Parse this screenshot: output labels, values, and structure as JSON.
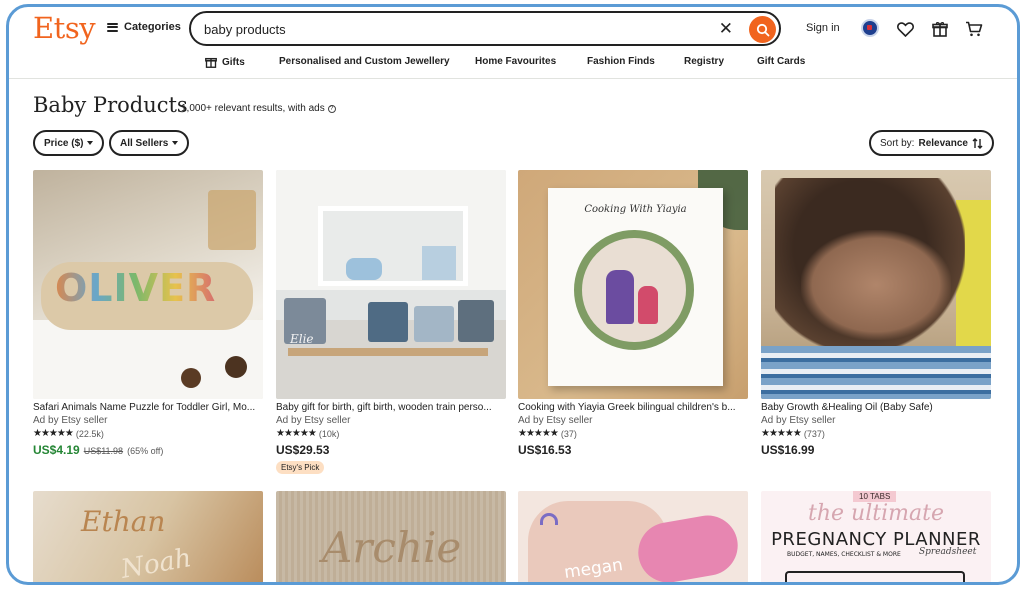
{
  "header": {
    "logo": "Etsy",
    "categories_label": "Categories",
    "search_value": "baby products",
    "signin_label": "Sign in"
  },
  "nav": [
    "Gifts",
    "Personalised and Custom Jewellery",
    "Home Favourites",
    "Fashion Finds",
    "Registry",
    "Gift Cards"
  ],
  "page": {
    "title": "Baby Products",
    "results": "1,000+ relevant results, with ads"
  },
  "filters": {
    "price": "Price ($)",
    "sellers": "All Sellers",
    "sort_prefix": "Sort by:",
    "sort_value": "Relevance"
  },
  "products": [
    {
      "title": "Safari Animals Name Puzzle for Toddler Girl, Mo...",
      "seller": "Ad by Etsy seller",
      "stars": "★★★★★",
      "reviews": "(22.5k)",
      "price": "US$4.19",
      "original_price": "US$11.98",
      "discount": "(65% off)",
      "image_text": "OLIVER"
    },
    {
      "title": "Baby gift for birth, gift birth, wooden train perso...",
      "seller": "Ad by Etsy seller",
      "stars": "★★★★★",
      "reviews": "(10k)",
      "price": "US$29.53",
      "badge": "Etsy's Pick",
      "image_text": "Elie"
    },
    {
      "title": "Cooking with Yiayia Greek bilingual children's b...",
      "seller": "Ad by Etsy seller",
      "stars": "★★★★★",
      "reviews": "(37)",
      "price": "US$16.53",
      "image_text": "Cooking With Yiayia"
    },
    {
      "title": "Baby Growth &Healing Oil (Baby Safe)",
      "seller": "Ad by Etsy seller",
      "stars": "★★★★★",
      "reviews": "(737)",
      "price": "US$16.99"
    }
  ],
  "bottom_images": [
    {
      "text1": "Ethan",
      "text2": "Noah"
    },
    {
      "text1": "Archie"
    },
    {
      "text1": "megan"
    },
    {
      "tag": "10 TABS",
      "script": "the ultimate",
      "headline": "PREGNANCY PLANNER",
      "sub": "BUDGET, NAMES, CHECKLIST & MORE",
      "script2": "Spreadsheet"
    }
  ],
  "colors": {
    "brand": "#f1641e",
    "sale_green": "#258635",
    "frame": "#5b9bd5"
  }
}
